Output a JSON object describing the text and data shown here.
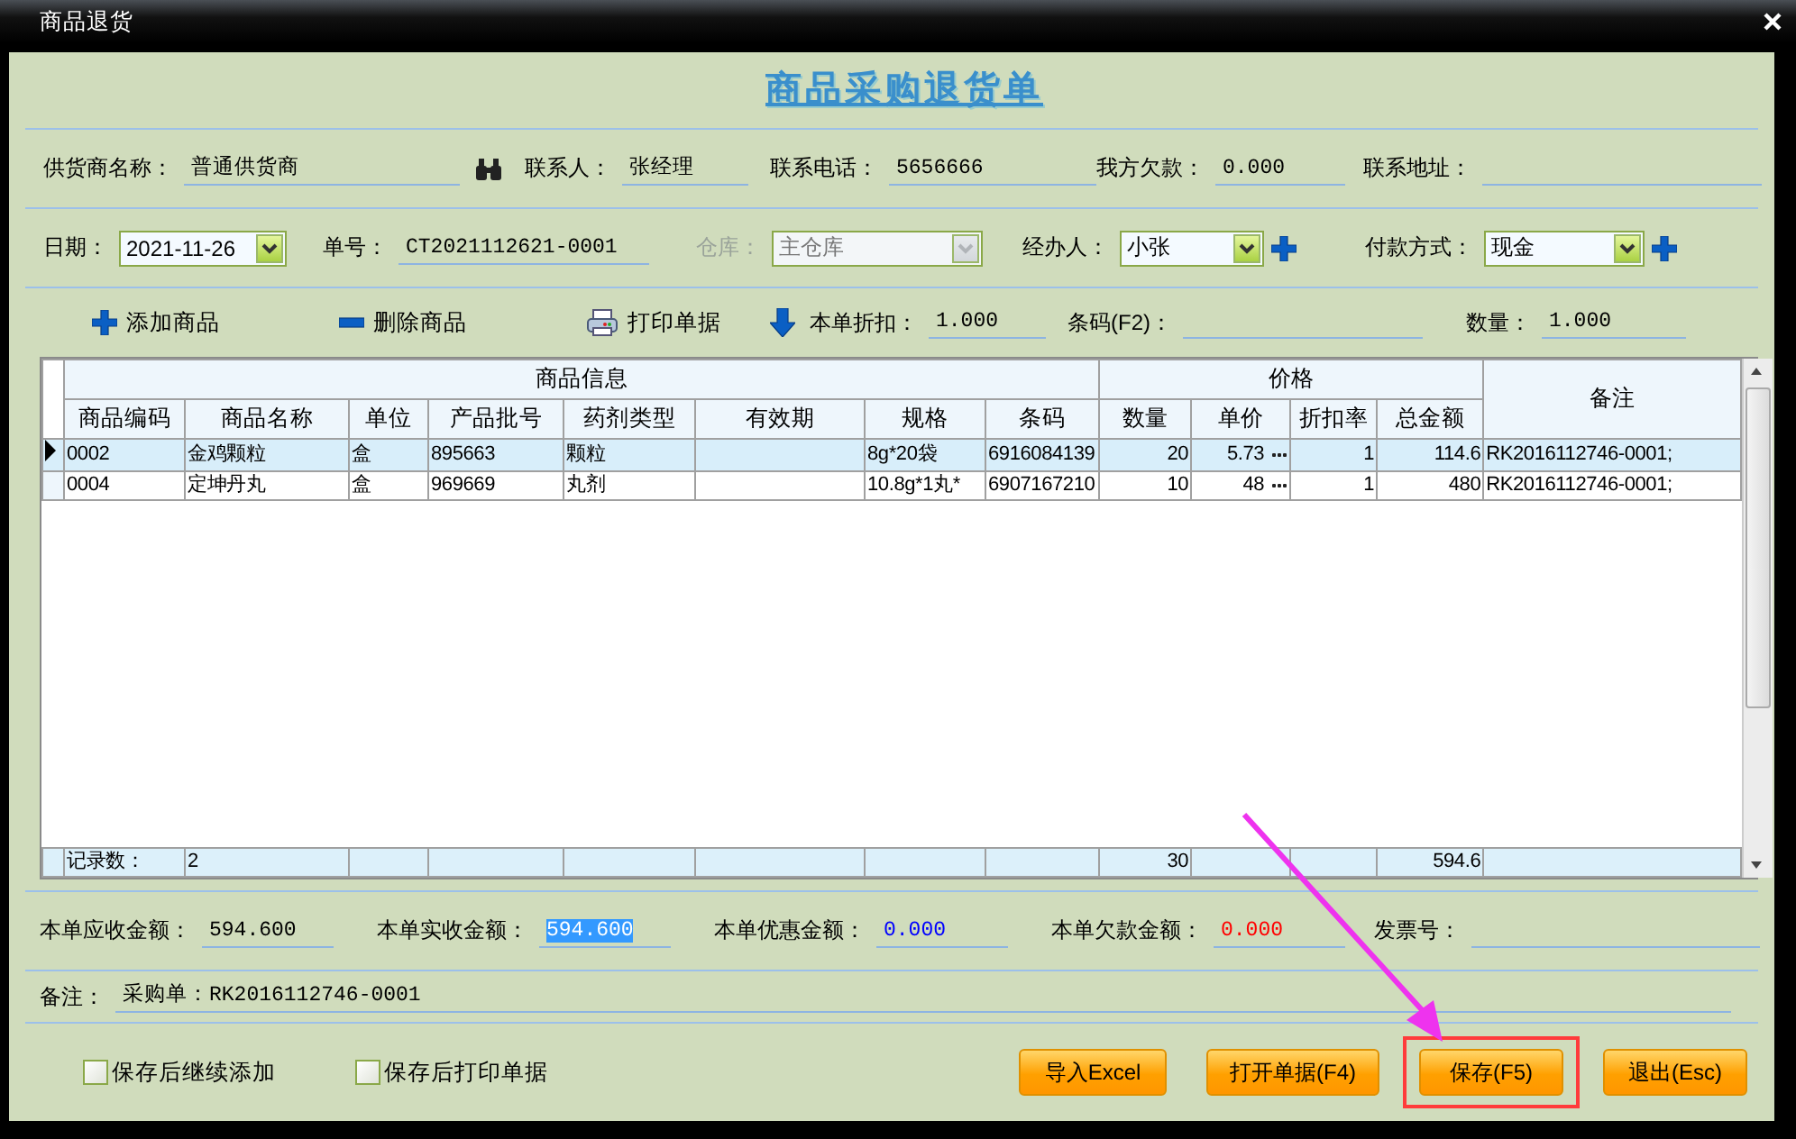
{
  "window": {
    "title": "商品退货"
  },
  "form_title": "商品采购退货单",
  "supplier_row": [
    {
      "kind": "text",
      "label": "供货商名称：",
      "value": "普通供货商"
    },
    {
      "kind": "search_button"
    },
    {
      "kind": "text",
      "label": "联系人：",
      "value": "张经理"
    },
    {
      "kind": "text",
      "label": "联系电话：",
      "value": "5656666"
    },
    {
      "kind": "text",
      "label": "我方欠款：",
      "value": "0.000"
    },
    {
      "kind": "text",
      "label": "联系地址："
    }
  ],
  "order_row": [
    {
      "kind": "select",
      "label": "日期：",
      "value": "2021-11-26",
      "disabled": false
    },
    {
      "kind": "text",
      "label": "单号：",
      "value": "CT2021112621-0001"
    },
    {
      "kind": "select",
      "label": "仓库：",
      "value": "主仓库",
      "disabled": true
    },
    {
      "kind": "select",
      "label": "经办人：",
      "value": "小张",
      "disabled": false
    },
    {
      "kind": "add_button"
    },
    {
      "kind": "select",
      "label": "付款方式：",
      "value": "现金",
      "disabled": false
    },
    {
      "kind": "add_button"
    }
  ],
  "toolbar": [
    {
      "kind": "add",
      "label": "添加商品"
    },
    {
      "kind": "remove",
      "label": "删除商品"
    },
    {
      "kind": "print",
      "label": "打印单据"
    },
    {
      "kind": "down"
    },
    {
      "kind": "text",
      "label": "本单折扣：",
      "value": "1.000"
    },
    {
      "kind": "text",
      "label": "条码(F2)："
    },
    {
      "kind": "text",
      "label": "数量：",
      "value": "1.000"
    }
  ],
  "table": {
    "column_groups": [
      {
        "label": "商品信息",
        "columns": [
          {
            "label": "商品编码",
            "kind": "text"
          },
          {
            "label": "商品名称",
            "kind": "text"
          },
          {
            "label": "单位",
            "kind": "text"
          },
          {
            "label": "产品批号",
            "kind": "text"
          },
          {
            "label": "药剂类型",
            "kind": "text"
          },
          {
            "label": "有效期",
            "kind": "text"
          },
          {
            "label": "规格",
            "kind": "text"
          },
          {
            "label": "条码",
            "kind": "text"
          }
        ]
      },
      {
        "label": "价格",
        "columns": [
          {
            "label": "数量",
            "kind": "number"
          },
          {
            "label": "单价",
            "kind": "price"
          },
          {
            "label": "折扣率",
            "kind": "number"
          },
          {
            "label": "总金额",
            "kind": "number"
          }
        ]
      }
    ],
    "last_column": "备注",
    "rows": [
      {
        "selected": true,
        "cells": [
          "0002",
          "金鸡颗粒",
          "盒",
          "895663",
          "颗粒",
          null,
          "8g*20袋",
          "6916084139",
          "20",
          "5.73",
          "1",
          "114.6",
          "RK2016112746-0001;"
        ]
      },
      {
        "selected": false,
        "cells": [
          "0004",
          "定坤丹丸",
          "盒",
          "969669",
          "丸剂",
          null,
          "10.8g*1丸*",
          "6907167210",
          "10",
          "48",
          "1",
          "480",
          "RK2016112746-0001;"
        ]
      }
    ],
    "footer": {
      "label": "记录数：",
      "count": "2",
      "quantity": "30",
      "total": "594.6"
    }
  },
  "summary": [
    {
      "label": "本单应收金额：",
      "value": "594.600",
      "highlighted": false
    },
    {
      "label": "本单实收金额：",
      "value": "594.600",
      "highlighted": true
    },
    {
      "label": "本单优惠金额：",
      "value": "0.000",
      "highlighted": false,
      "color": "#0000ff"
    },
    {
      "label": "本单欠款金额：",
      "value": "0.000",
      "highlighted": false,
      "color": "#ff0000"
    },
    {
      "label": "发票号："
    }
  ],
  "remark": {
    "label": "备注：",
    "value": "采购单：RK2016112746-0001"
  },
  "options": [
    {
      "label": "保存后继续添加",
      "checked": false
    },
    {
      "label": "保存后打印单据",
      "checked": false
    }
  ],
  "buttons": [
    {
      "label": "导入Excel",
      "highlighted": false
    },
    {
      "label": "打开单据(F4)",
      "highlighted": false
    },
    {
      "label": "保存(F5)",
      "highlighted": true
    },
    {
      "label": "退出(Esc)",
      "highlighted": false
    }
  ]
}
